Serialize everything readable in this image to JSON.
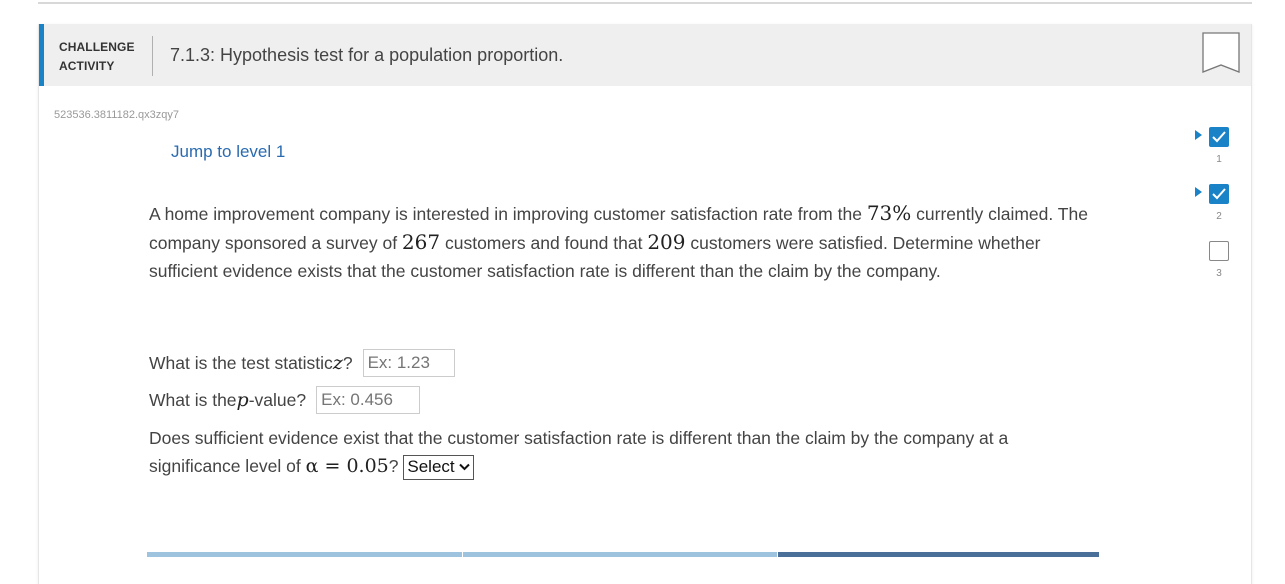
{
  "activity": {
    "label_line1": "CHALLENGE",
    "label_line2": "ACTIVITY",
    "title": "7.1.3: Hypothesis test for a population proportion.",
    "id": "523536.3811182.qx3zqy7",
    "jump_link": "Jump to level 1"
  },
  "problem": {
    "p1": "A home improvement company is interested in improving customer satisfaction rate from the ",
    "claim_rate": "73%",
    "p2": " currently claimed. The company sponsored a survey of ",
    "survey_n": "267",
    "p3": " customers and found that ",
    "satisfied_n": "209",
    "p4": " customers were satisfied. Determine whether sufficient evidence exists that the customer satisfaction rate is different than the claim by the company."
  },
  "questions": {
    "q1_before": "What is the test statistic ",
    "q1_var": "z",
    "q1_after": "?",
    "q1_placeholder": "Ex: 1.23",
    "q2_before": "What is the ",
    "q2_var": "p",
    "q2_after": "-value?",
    "q2_placeholder": "Ex: 0.456",
    "q3_text": "Does sufficient evidence exist that the customer satisfaction rate is different than the claim by the company at a significance level of ",
    "q3_alpha": "α = 0.05",
    "q3_after": "?",
    "q3_select": "Select"
  },
  "levels": [
    {
      "num": "1",
      "done": true
    },
    {
      "num": "2",
      "done": true
    },
    {
      "num": "3",
      "done": false
    }
  ],
  "colors": {
    "accent": "#1a82c6",
    "link": "#2a6bb0",
    "header_bg": "#efefef"
  }
}
